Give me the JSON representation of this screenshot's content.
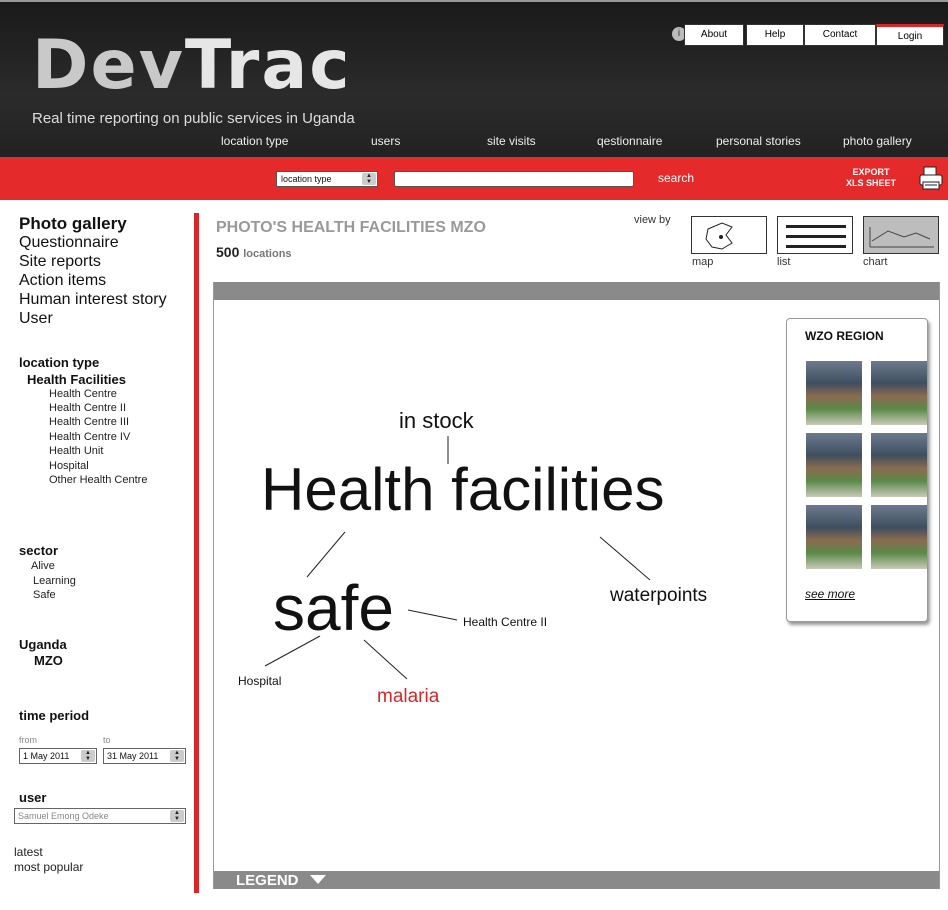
{
  "app": {
    "logo_dev": "Dev",
    "logo_trac": "Trac",
    "tagline": "Real time reporting on public services in Uganda"
  },
  "top_buttons": [
    "About",
    "Help",
    "Contact",
    "Login"
  ],
  "nav": [
    "location type",
    "users",
    "site visits",
    "qestionnaire",
    "personal stories",
    "photo gallery"
  ],
  "search": {
    "select_value": "location type",
    "label": "search",
    "export_line1": "EXPORT",
    "export_line2": "XLS SHEET"
  },
  "sidebar": {
    "links": [
      "Photo gallery",
      "Questionnaire",
      "Site reports",
      "Action items",
      "Human interest story",
      "User"
    ],
    "location_type_heading": "location type",
    "location_group": "Health Facilities",
    "location_items": [
      "Health Centre",
      "Health Centre II",
      "Health Centre III",
      "Health Centre IV",
      "Health Unit",
      "Hospital",
      "Other Health Centre"
    ],
    "sector_heading": "sector",
    "sector_items": [
      "Alive",
      "Learning",
      "Safe"
    ],
    "country": "Uganda",
    "region": "MZO",
    "time_heading": "time period",
    "from_label": "from",
    "to_label": "to",
    "from_value": "1 May 2011",
    "to_value": "31 May 2011",
    "user_heading": "user",
    "user_value": "Samuel Emong Odeke",
    "sort_latest": "latest",
    "sort_popular": "most popular"
  },
  "main": {
    "title": "PHOTO'S HEALTH FACILITIES MZO",
    "count": "500",
    "count_label": "locations",
    "view_by": "view by",
    "views": [
      "map",
      "list",
      "chart"
    ],
    "legend": "LEGEND"
  },
  "cloud": {
    "in_stock": "in stock",
    "health_facilities": "Health facilities",
    "safe": "safe",
    "waterpoints": "waterpoints",
    "health_centre_ii": "Health Centre II",
    "hospital": "Hospital",
    "malaria": "malaria"
  },
  "region_panel": {
    "title": "WZO REGION",
    "see_more": "see more",
    "photo_count": 6
  },
  "colors": {
    "accent_red": "#e42a2a",
    "header_dark": "#222222",
    "malaria_red": "#d62828"
  }
}
